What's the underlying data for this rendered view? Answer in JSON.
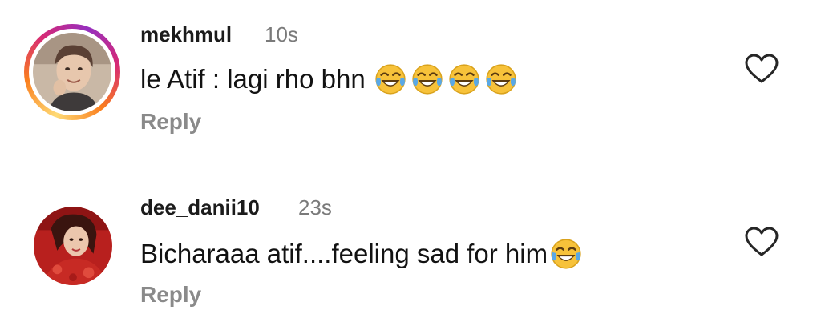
{
  "comments": [
    {
      "username": "mekhmul",
      "time": "10s",
      "text": "le Atif : lagi rho bhn",
      "emoji_count": 4,
      "reply_label": "Reply",
      "has_story_ring": true
    },
    {
      "username": "dee_danii10",
      "time": "23s",
      "text": "Bicharaaa atif....feeling sad for him",
      "emoji_count": 1,
      "reply_label": "Reply",
      "has_story_ring": false
    }
  ],
  "icons": {
    "like": "heart-outline-icon",
    "emoji": "face-with-tears-of-joy-icon"
  },
  "colors": {
    "username": "#1b1b1b",
    "timestamp": "#7a7a7a",
    "reply": "#8a8a8a",
    "ring_start": "#feda75",
    "ring_end": "#962fbf"
  }
}
